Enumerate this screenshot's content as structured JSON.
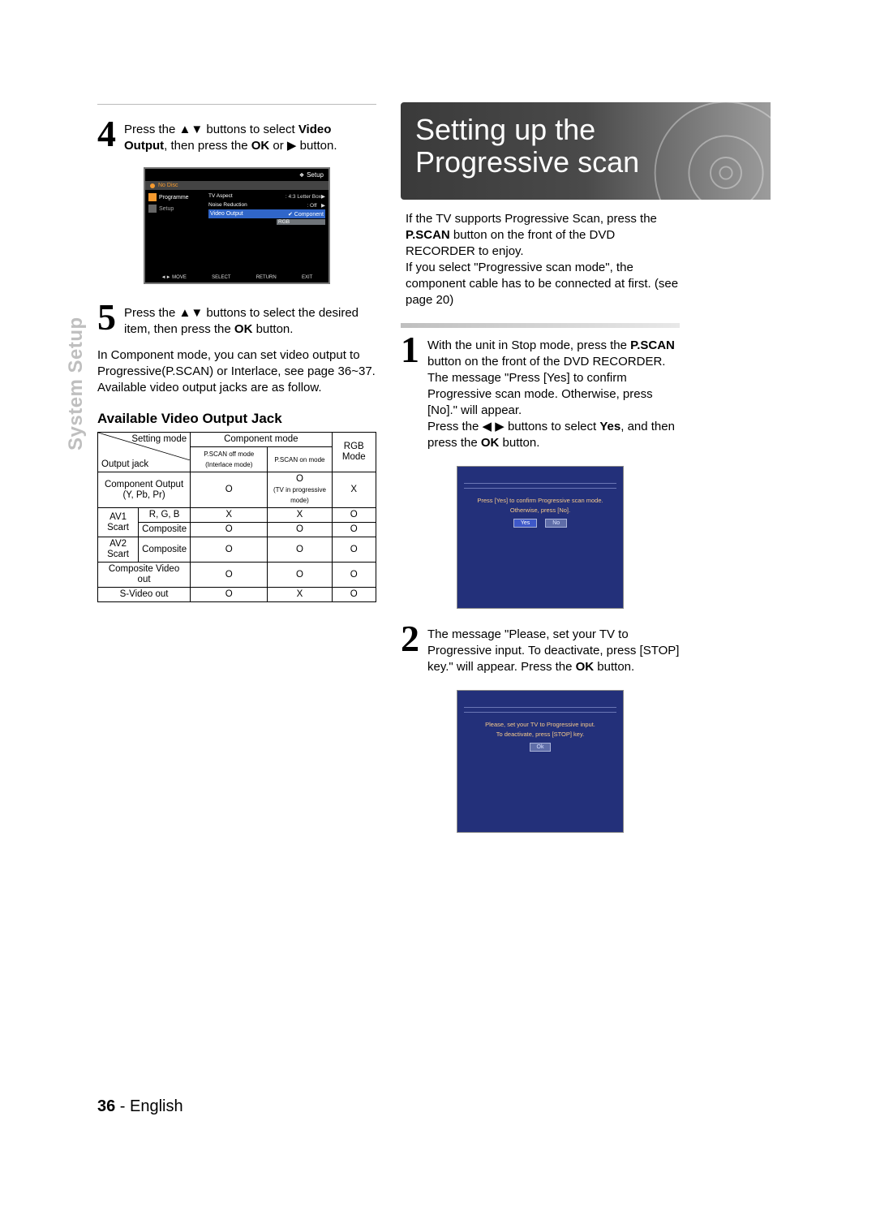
{
  "page_number": "36",
  "language": "English",
  "side_label": "System Setup",
  "left": {
    "step4_num": "4",
    "step4_text_a": "Press the ",
    "step4_text_b": " buttons to select ",
    "step4_bold1": "Video Output",
    "step4_text_c": ", then press the ",
    "step4_bold2": "OK",
    "step4_text_d": " or ",
    "step4_text_e": " button.",
    "step5_num": "5",
    "step5_text_a": "Press the ",
    "step5_text_b": " buttons to select the desired item, then press the ",
    "step5_bold": "OK",
    "step5_text_c": " button.",
    "comp_note_a": "In Component mode, you can set video output to Progressive(P.SCAN) or Interlace, see page 36~37.",
    "comp_note_b": "Available video output jacks are as follow.",
    "table_heading": "Available Video Output Jack",
    "table": {
      "diag_tl": "Output jack",
      "diag_br": "Setting mode",
      "comp_header": "Component mode",
      "comp_sub1": "P.SCAN off mode (Interlace mode)",
      "comp_sub2": "P.SCAN on mode",
      "rgb_header": "RGB Mode",
      "rows": [
        {
          "label": "Component Output\n(Y, Pb, Pr)",
          "sub": "",
          "a": "O",
          "b": "O",
          "b_note": "(TV in progressive mode)",
          "c": "X"
        },
        {
          "label": "AV1 Scart",
          "sub": "R, G, B",
          "a": "X",
          "b": "X",
          "c": "O"
        },
        {
          "label": "",
          "sub": "Composite",
          "a": "O",
          "b": "O",
          "c": "O"
        },
        {
          "label": "AV2 Scart",
          "sub": "Composite",
          "a": "O",
          "b": "O",
          "c": "O"
        },
        {
          "label": "Composite Video out",
          "sub": "",
          "a": "O",
          "b": "O",
          "c": "O"
        },
        {
          "label": "S-Video out",
          "sub": "",
          "a": "O",
          "b": "X",
          "c": "O"
        }
      ]
    },
    "tv": {
      "top_label": "Setup",
      "nodisc": "No Disc",
      "side_prog": "Programme",
      "side_setup": "Setup",
      "row1_k": "TV Aspect",
      "row1_v": "4:3 Letter Box",
      "row2_k": "Noise Reduction",
      "row2_v": "Off",
      "row3_k": "Video Output",
      "row3_v": "Component",
      "opt2": "RGB",
      "bot1": "MOVE",
      "bot2": "SELECT",
      "bot3": "RETURN",
      "bot4": "EXIT"
    }
  },
  "right": {
    "title_line1": "Setting up the",
    "title_line2": "Progressive scan",
    "intro_a": "If the TV supports Progressive Scan, press the ",
    "intro_b": "P.SCAN",
    "intro_c": " button on the front of the DVD RECORDER to enjoy.",
    "intro_d": "If you select \"Progressive scan mode\", the component cable has to be connected at first. (see page 20)",
    "step1_num": "1",
    "s1a": "With the unit in Stop mode, press the ",
    "s1b": "P.SCAN",
    "s1c": " button on the front of the DVD RECORDER.",
    "s1d": "The message \"Press [Yes] to confirm Progressive scan mode. Otherwise, press [No].\" will appear.",
    "s1e": "Press the ",
    "s1f": " buttons to select ",
    "s1g": "Yes",
    "s1h": ", and then press the ",
    "s1i": "OK",
    "s1j": " button.",
    "blue1_l1": "Press [Yes] to confirm Progressive scan mode.",
    "blue1_l2": "Otherwise, press [No].",
    "blue1_yes": "Yes",
    "blue1_no": "No",
    "step2_num": "2",
    "s2a": "The message \"Please, set your TV to Progressive input. To deactivate, press [STOP] key.\" will appear. Press the ",
    "s2b": "OK",
    "s2c": " button.",
    "blue2_l1": "Please, set your TV to Progressive input.",
    "blue2_l2": "To deactivate, press [STOP] key.",
    "blue2_ok": "Ok"
  }
}
